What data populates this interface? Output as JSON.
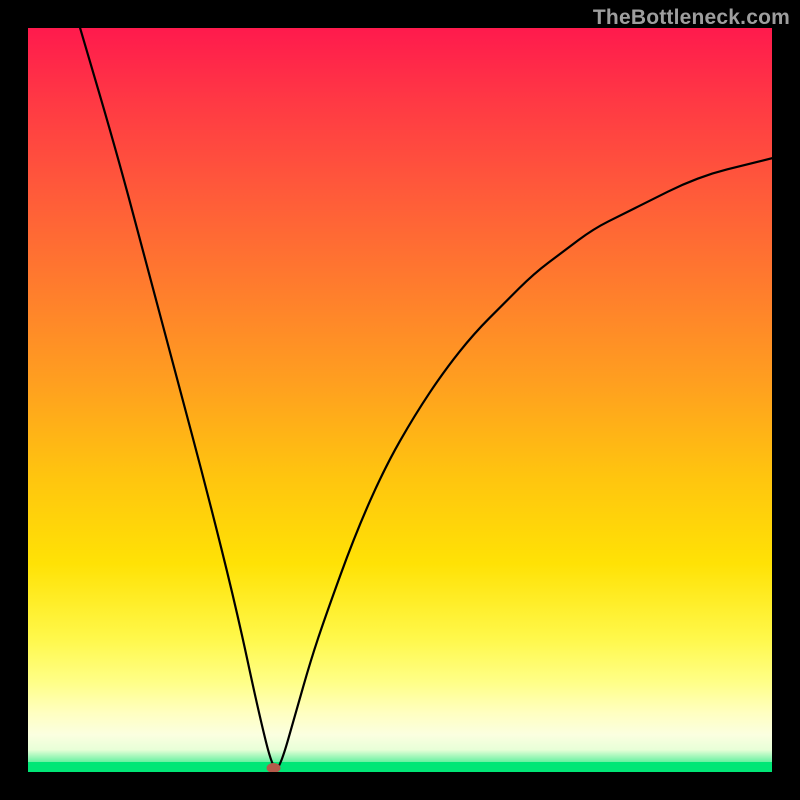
{
  "watermark": {
    "text": "TheBottleneck.com"
  },
  "chart_data": {
    "type": "line",
    "title": "",
    "subtitle": "",
    "xlabel": "",
    "ylabel": "",
    "xlim": [
      0,
      100
    ],
    "ylim": [
      0,
      100
    ],
    "legend": false,
    "grid": false,
    "minimum_point": {
      "x": 33,
      "y": 0,
      "color": "#b55a4a"
    },
    "series": [
      {
        "name": "bottleneck-curve",
        "description": "V-shaped bottleneck curve: starts at top-left, descends steeply to minimum near x≈33, then rises with decreasing slope toward upper-right",
        "x": [
          7,
          12,
          16,
          20,
          24,
          28,
          31,
          33,
          34,
          36,
          38,
          40,
          44,
          48,
          52,
          56,
          60,
          64,
          68,
          72,
          76,
          80,
          84,
          88,
          92,
          96,
          100
        ],
        "values": [
          100,
          83,
          68,
          53,
          38,
          22,
          8,
          0,
          1,
          8,
          15,
          21,
          32,
          41,
          48,
          54,
          59,
          63,
          67,
          70,
          73,
          75,
          77,
          79,
          80.5,
          81.5,
          82.5
        ]
      }
    ],
    "background_gradient": {
      "direction": "top-to-bottom",
      "stops": [
        {
          "pos": 0.0,
          "color": "#ff1a4d"
        },
        {
          "pos": 0.22,
          "color": "#ff5a3a"
        },
        {
          "pos": 0.48,
          "color": "#ffa01f"
        },
        {
          "pos": 0.72,
          "color": "#ffe205"
        },
        {
          "pos": 0.92,
          "color": "#ffffc0"
        },
        {
          "pos": 1.0,
          "color": "#00e676"
        }
      ]
    }
  }
}
